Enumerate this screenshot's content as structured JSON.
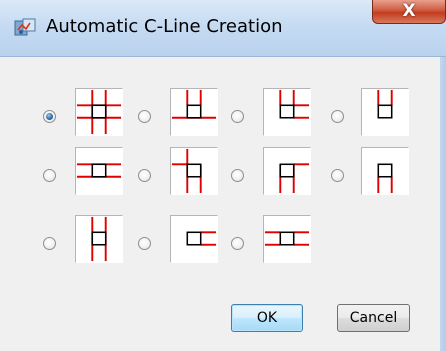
{
  "window": {
    "title": "Automatic C-Line Creation",
    "close_glyph": "X",
    "icon": "app-icon"
  },
  "options": {
    "selected_index": 0,
    "items": [
      {
        "pattern": "cross-both-full"
      },
      {
        "pattern": "vertical-top-horizontal-full"
      },
      {
        "pattern": "vertical-top-horizontal-right"
      },
      {
        "pattern": "vertical-top-only"
      },
      {
        "pattern": "horizontal-full"
      },
      {
        "pattern": "vertical-bottom-horizontal-left"
      },
      {
        "pattern": "vertical-bottom-horizontal-right"
      },
      {
        "pattern": "vertical-bottom-only"
      },
      {
        "pattern": "vertical-full"
      },
      {
        "pattern": "horizontal-right"
      },
      {
        "pattern": "horizontal-left-right-short"
      }
    ]
  },
  "buttons": {
    "ok_label": "OK",
    "cancel_label": "Cancel"
  },
  "colors": {
    "c_line": "#e00000",
    "outline": "#000000",
    "title_gradient_top": "#dbe9f8",
    "close_button": "#c23c1e",
    "default_button_border": "#3c7fb1"
  }
}
